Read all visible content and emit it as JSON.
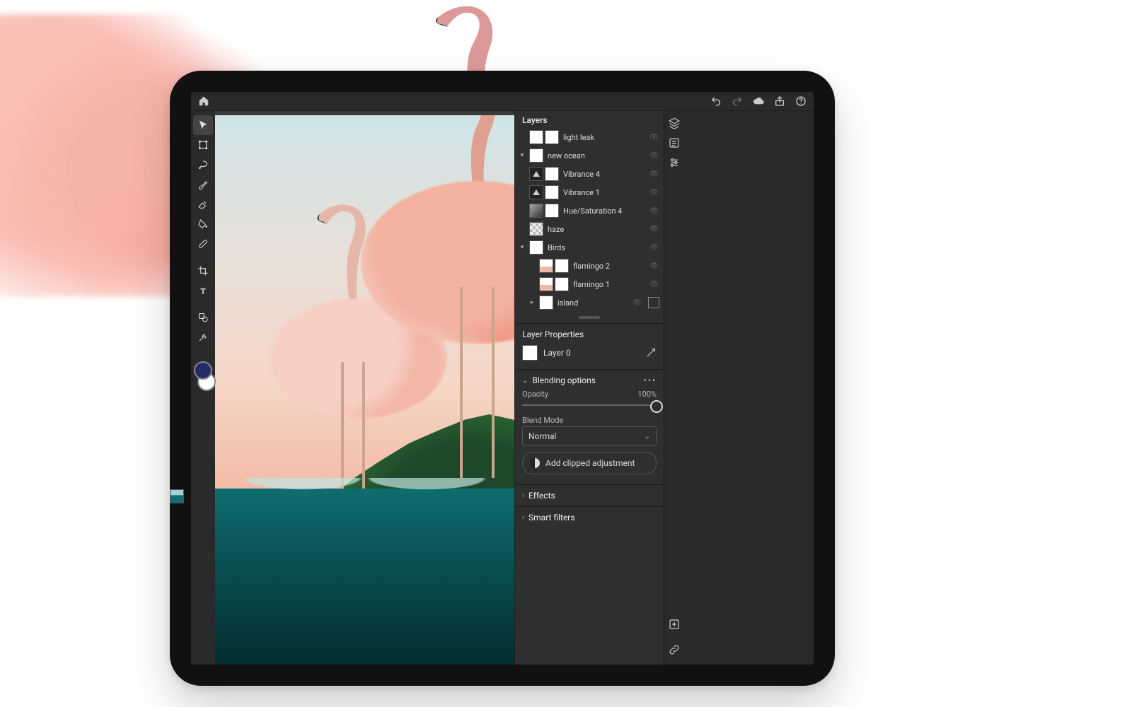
{
  "topbar": {
    "home_icon": "home-icon",
    "undo_icon": "undo-icon",
    "redo_icon": "redo-icon",
    "cloud_icon": "cloud-icon",
    "share_icon": "share-icon",
    "help_icon": "help-icon"
  },
  "tools": [
    {
      "name": "move-tool",
      "icon": "cursor"
    },
    {
      "name": "transform-tool",
      "icon": "transform"
    },
    {
      "name": "lasso-tool",
      "icon": "lasso"
    },
    {
      "name": "brush-tool",
      "icon": "brush"
    },
    {
      "name": "eraser-tool",
      "icon": "eraser"
    },
    {
      "name": "fill-tool",
      "icon": "bucket"
    },
    {
      "name": "heal-tool",
      "icon": "bandaid"
    },
    {
      "name": "crop-tool",
      "icon": "crop"
    },
    {
      "name": "type-tool",
      "icon": "type"
    },
    {
      "name": "shapes-tool",
      "icon": "shapes"
    },
    {
      "name": "eyedropper-tool",
      "icon": "eyedropper"
    }
  ],
  "colors": {
    "foreground": "#222c66",
    "background": "#ffffff"
  },
  "layers_panel": {
    "title": "Layers",
    "items": [
      {
        "name": "light leak",
        "thumb": "white",
        "mask": true
      },
      {
        "name": "new ocean",
        "thumb": "sea",
        "mask": true,
        "group": true,
        "expanded": true
      },
      {
        "name": "Vibrance 4",
        "thumb": "tri",
        "mask": true
      },
      {
        "name": "Vibrance 1",
        "thumb": "tri",
        "mask": true
      },
      {
        "name": "Hue/Saturation 4",
        "thumb": "grad",
        "mask": true
      },
      {
        "name": "haze",
        "thumb": "haze",
        "mask": false
      },
      {
        "name": "Birds",
        "thumb": "bird",
        "group": true,
        "expanded": true
      },
      {
        "name": "flamingo 2",
        "thumb": "flm",
        "mask": true,
        "child": true
      },
      {
        "name": "flamingo 1",
        "thumb": "flm",
        "mask": true,
        "child": true
      },
      {
        "name": "island",
        "thumb": "sea",
        "mask": true,
        "group": true,
        "child": true,
        "extra": true
      }
    ]
  },
  "ministrip": [
    {
      "name": "layers-panel-icon"
    },
    {
      "name": "layer-options-icon"
    },
    {
      "name": "adjustments-icon"
    }
  ],
  "layer_properties": {
    "title": "Layer Properties",
    "layer_name": "Layer 0"
  },
  "blending": {
    "title": "Blending options",
    "opacity_label": "Opacity",
    "opacity_value": "100%",
    "opacity_pct": 100,
    "mode_label": "Blend Mode",
    "mode_value": "Normal",
    "add_adjustment": "Add clipped adjustment"
  },
  "effects": {
    "title": "Effects"
  },
  "smart": {
    "title": "Smart filters"
  }
}
